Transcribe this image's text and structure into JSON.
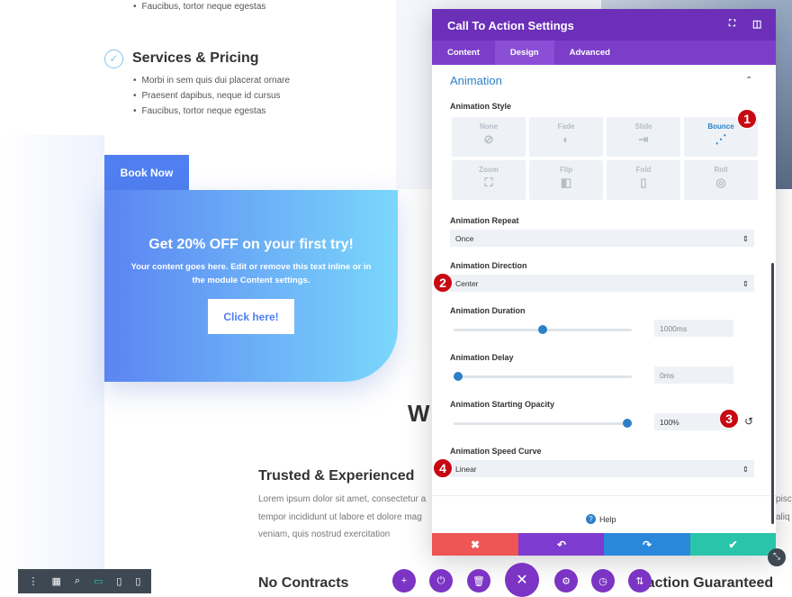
{
  "page": {
    "bullets_top": [
      "Faucibus, tortor neque egestas"
    ],
    "services": {
      "title": "Services & Pricing",
      "bullets": [
        "Morbi in sem quis dui placerat ornare",
        "Praesent dapibus, neque id cursus",
        "Faucibus, tortor neque egestas"
      ]
    },
    "book_now": "Book Now",
    "cta": {
      "title": "Get 20% OFF on your first try!",
      "body": "Your content goes here. Edit or remove this text inline or in the module Content settings.",
      "button": "Click here!"
    },
    "partial_heading": "W",
    "trusted": {
      "title": "Trusted & Experienced",
      "lines": [
        "Lorem ipsum dolor sit amet, consectetur a",
        "tempor incididunt ut labore et dolore mag",
        "veniam, quis nostrud exercitation"
      ],
      "right_fragments": [
        "pisci",
        "aliq"
      ]
    },
    "no_contracts": "No Contracts",
    "satisfaction": "isfaction Guaranteed"
  },
  "panel": {
    "title": "Call To Action Settings",
    "tabs": [
      {
        "label": "Content"
      },
      {
        "label": "Design",
        "active": true
      },
      {
        "label": "Advanced"
      }
    ],
    "section": "Animation",
    "style_label": "Animation Style",
    "styles": [
      {
        "label": "None",
        "icon": "⊘"
      },
      {
        "label": "Fade",
        "icon": "◐"
      },
      {
        "label": "Slide",
        "icon": "⇥"
      },
      {
        "label": "Bounce",
        "icon": "⋰",
        "selected": true
      },
      {
        "label": "Zoom",
        "icon": "⛶"
      },
      {
        "label": "Flip",
        "icon": "◧"
      },
      {
        "label": "Fold",
        "icon": "▯"
      },
      {
        "label": "Roll",
        "icon": "◎"
      }
    ],
    "repeat": {
      "label": "Animation Repeat",
      "value": "Once"
    },
    "direction": {
      "label": "Animation Direction",
      "value": "Center"
    },
    "duration": {
      "label": "Animation Duration",
      "value": "1000ms",
      "fraction": 0.5
    },
    "delay": {
      "label": "Animation Delay",
      "value": "0ms",
      "fraction": 0
    },
    "opacity": {
      "label": "Animation Starting Opacity",
      "value": "100%",
      "fraction": 1
    },
    "speed_curve": {
      "label": "Animation Speed Curve",
      "value": "Linear"
    },
    "help": "Help",
    "badges": [
      "1",
      "2",
      "3",
      "4"
    ],
    "footer_colors": {
      "cancel": "#ef5555",
      "undo": "#7d3bcf",
      "redo": "#2b87da",
      "save": "#29c4a9"
    }
  },
  "colors": {
    "purple": "#6b2fb8",
    "accent_blue": "#2d80c6",
    "badge_red": "#c80812"
  }
}
